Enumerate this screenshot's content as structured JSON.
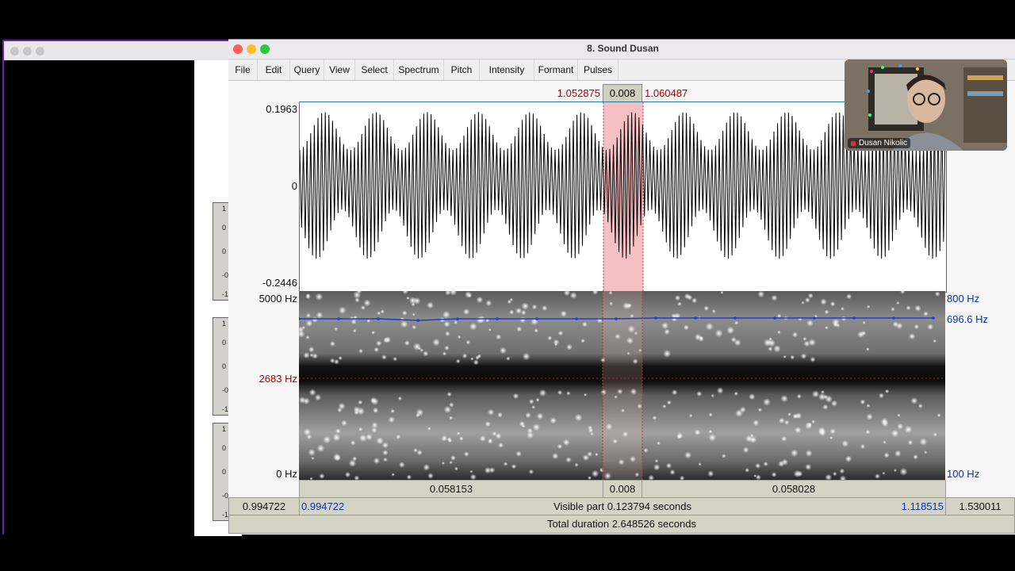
{
  "window": {
    "title": "8. Sound Dusan",
    "menu": [
      "File",
      "Edit",
      "Query",
      "View",
      "Select",
      "Spectrum",
      "Pitch",
      "Intensity",
      "Formant",
      "Pulses"
    ]
  },
  "selection": {
    "start": "1.052875",
    "duration": "0.008",
    "end": "1.060487"
  },
  "waveform": {
    "max": "0.1963",
    "zero": "0",
    "min": "-0.2446"
  },
  "spectrogram": {
    "top_freq": "5000 Hz",
    "cursor_freq": "2683 Hz",
    "bottom_freq": "0 Hz",
    "pitch_top": "800 Hz",
    "pitch_value": "696.6 Hz",
    "pitch_bottom": "100 Hz"
  },
  "time_bar": {
    "left_segment": "0.058153",
    "selected_segment": "0.008",
    "right_segment": "0.058028"
  },
  "visible_bar": {
    "window_start": "0.994722",
    "visible_start": "0.994722",
    "visible_text": "Visible part 0.123794 seconds",
    "visible_end": "1.118515",
    "window_end": "1.530011"
  },
  "total_bar": {
    "text": "Total duration 2.648526 seconds"
  },
  "mini_tracks": {
    "labels": [
      "1",
      "0",
      "0",
      "-0",
      "-1"
    ]
  },
  "webcam": {
    "name": "Dusan Nikolic"
  },
  "colors": {
    "selection": "#f4c0c4",
    "pitch_line": "#1a40c8",
    "red_label": "#b00000",
    "blue_label": "#1030b0"
  }
}
